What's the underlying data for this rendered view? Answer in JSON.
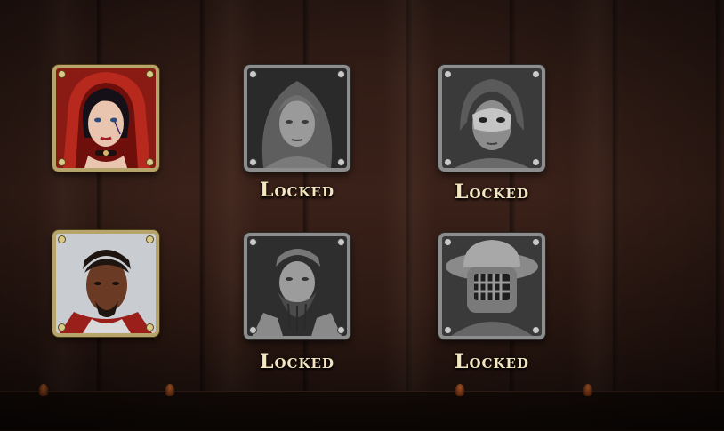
{
  "characters": [
    {
      "id": "red-hood",
      "locked": false,
      "label": "",
      "icon": "red-hooded-woman-portrait"
    },
    {
      "id": "long-hair",
      "locked": true,
      "label": "Locked",
      "icon": "long-haired-woman-portrait"
    },
    {
      "id": "masked",
      "locked": true,
      "label": "Locked",
      "icon": "masked-figure-portrait"
    },
    {
      "id": "warrior",
      "locked": false,
      "label": "",
      "icon": "bearded-warrior-portrait"
    },
    {
      "id": "dwarf",
      "locked": true,
      "label": "Locked",
      "icon": "bearded-dwarf-portrait"
    },
    {
      "id": "gladiator",
      "locked": true,
      "label": "Locked",
      "icon": "helmeted-gladiator-portrait"
    }
  ],
  "colors": {
    "frame_gold": "#b7a46a",
    "frame_silver": "#8d8d8d",
    "label_text": "#f3e6c0",
    "background_wood": "#3a2119"
  }
}
